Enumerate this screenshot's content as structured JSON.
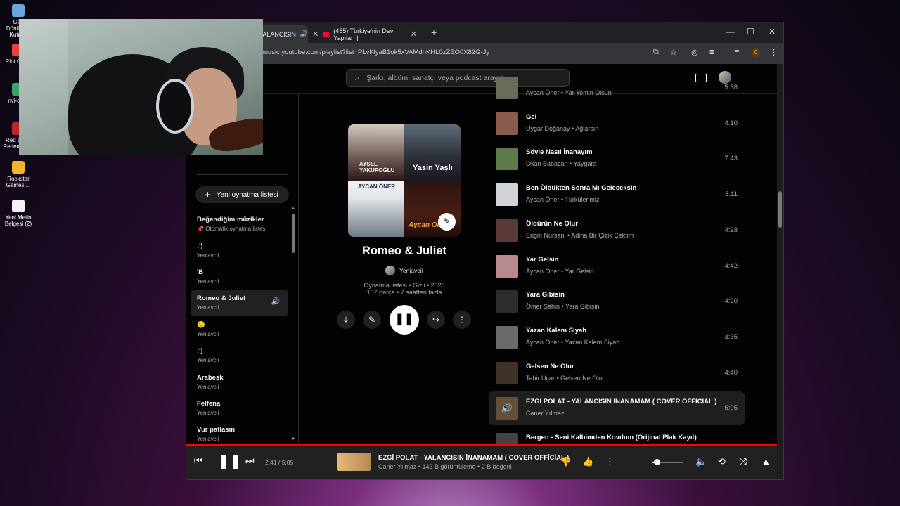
{
  "desktop": {
    "icons": [
      {
        "label": "Geri Dönüşüm Kutusu",
        "color": "#6aa7d9"
      },
      {
        "label": "Riot Client",
        "color": "#e8423b"
      },
      {
        "label": "nvi-coky",
        "color": "#3aa36a"
      },
      {
        "label": "Red Dead Redemption",
        "color": "#b8262b"
      },
      {
        "label": "Rockstar Games ...",
        "color": "#f3b52b"
      },
      {
        "label": "Yeni Metin Belgesi (2)",
        "color": "#f2f2f2"
      }
    ]
  },
  "browser": {
    "tabs": [
      {
        "label": "YALANCISIN",
        "active": true
      },
      {
        "label": "(455) Türkiye'nin Dev Yapıları | ",
        "active": false
      }
    ],
    "url": "music.youtube.com/playlist?list=PLvKlyaB1ok5xVAMdhKHL0zZEO0X82G-Jy",
    "extension_badge": "0"
  },
  "search": {
    "placeholder": "Şarkı, albüm, sanatçı veya podcast arayın"
  },
  "sidebar": {
    "new_playlist": "Yeni oynatma listesi",
    "items": [
      {
        "title": "Beğendiğim müzikler",
        "subtitle": "Otomatik oynatma listesi",
        "pinned": true
      },
      {
        "title": ":')",
        "subtitle": "Yeniavcii"
      },
      {
        "title": "'B",
        "subtitle": "Yeniavcii"
      },
      {
        "title": "Romeo & Juliet",
        "subtitle": "Yeniavcii",
        "active": true
      },
      {
        "title": "🙂",
        "subtitle": "Yeniavcii"
      },
      {
        "title": ":')",
        "subtitle": "Yeniavcii"
      },
      {
        "title": "Arabesk",
        "subtitle": "Yeniavcii"
      },
      {
        "title": "Felfena",
        "subtitle": "Yeniavcii"
      },
      {
        "title": "Vur patlasın",
        "subtitle": "Yeniavcii"
      }
    ]
  },
  "playlist": {
    "title": "Romeo & Juliet",
    "owner": "Yeniavcii",
    "meta_line1": "Oynatma listesi • Gizli • 2026",
    "meta_line2": "107 parça • 7 saatten fazla",
    "cover_captions": [
      "AYSEL YAKUPOĞLU",
      "Yasin Yaşlı",
      "AYCAN ÖNER",
      "Aycan Öner"
    ]
  },
  "tracks": [
    {
      "title": "",
      "artist": "Aycan Öner",
      "album": "Yar Yemin Olsun",
      "duration": "5:38",
      "color": "#6b6b5a"
    },
    {
      "title": "Gel",
      "artist": "Uygar Doğanay",
      "album": "Ağlarsın",
      "duration": "4:10",
      "color": "#8a5a4a"
    },
    {
      "title": "Söyle Nasıl İnanayım",
      "artist": "Okan Babacan",
      "album": "Yaygara",
      "duration": "7:43",
      "color": "#5e7a4a"
    },
    {
      "title": "Ben Öldükten Sonra Mı Geleceksin",
      "artist": "Aycan Öner",
      "album": "Türkülerimiz",
      "duration": "5:11",
      "color": "#cfd3d8"
    },
    {
      "title": "Öldürün Ne Olur",
      "artist": "Engin Nursani",
      "album": "Adina Bir Çizik Çektim",
      "duration": "4:28",
      "color": "#5a3a36"
    },
    {
      "title": "Yar Gelsin",
      "artist": "Aycan Öner",
      "album": "Yar Gelsin",
      "duration": "4:42",
      "color": "#b88a8e"
    },
    {
      "title": "Yara Gibisin",
      "artist": "Ömer Şahin",
      "album": "Yara Gibisin",
      "duration": "4:20",
      "color": "#2c2c2c"
    },
    {
      "title": "Yazan Kalem Siyah",
      "artist": "Aycan Öner",
      "album": "Yazan Kalem Siyah",
      "duration": "3:35",
      "color": "#6a6a6a"
    },
    {
      "title": "Gelsen Ne Olur",
      "artist": "Tahir Uçar",
      "album": "Gelsen Ne Olur",
      "duration": "4:40",
      "color": "#3d3226"
    },
    {
      "title": "EZGİ POLAT - YALANCISIN İNANAMAM ( COVER OFFİCİAL )",
      "artist": "Caner Yılmaz",
      "album": "",
      "duration": "5:05",
      "color": "#e0b07a",
      "current": true
    },
    {
      "title": "Bergen - Seni Kalbimden Kovdum (Orijinal Plak Kayıt)",
      "artist": "",
      "album": "",
      "duration": "",
      "color": "#444"
    }
  ],
  "player": {
    "time": "2:41 / 5:05",
    "progress": 0.527,
    "title": "EZGİ POLAT - YALANCISIN İNANAMAM ( COVER OFFİCİAL )",
    "subtitle": "Caner Yılmaz • 143 B görüntüleme • 2 B beğeni",
    "volume": 0.15
  },
  "colors": {
    "accent": "#ff0000",
    "bg": "#030303",
    "surface": "#212121"
  }
}
